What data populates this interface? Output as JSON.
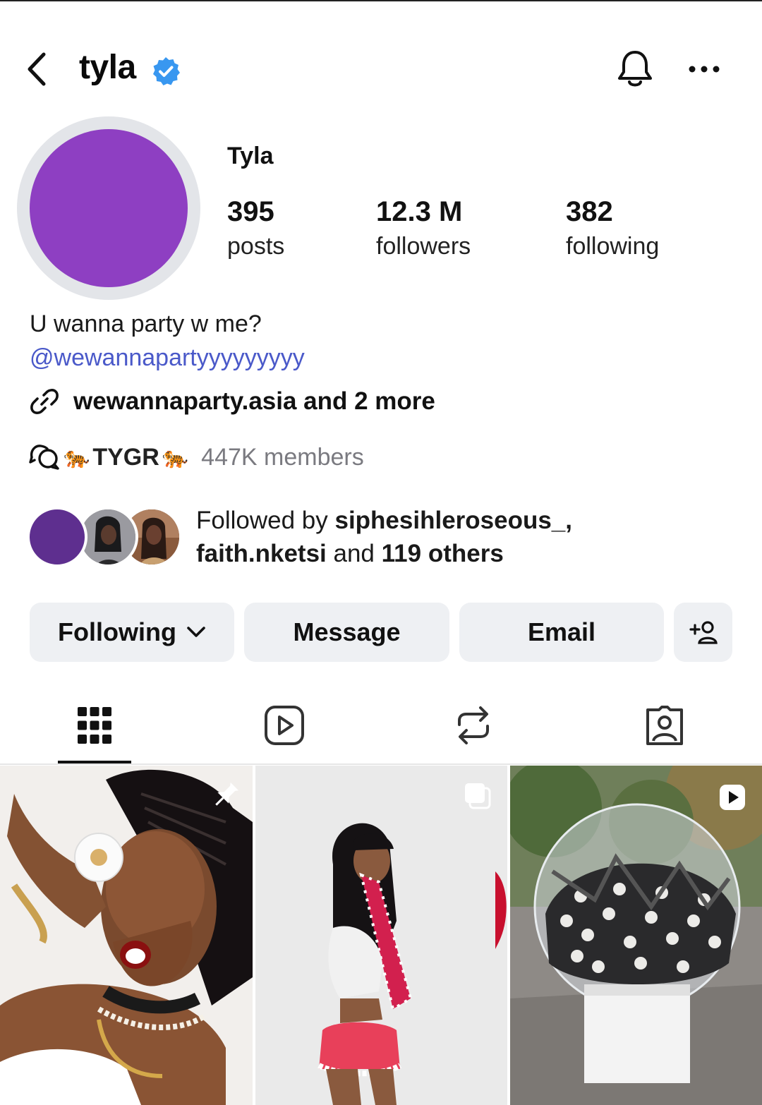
{
  "header": {
    "username": "tyla",
    "verified": true,
    "icons": {
      "back": "chevron-left-icon",
      "verified": "verified-badge-icon",
      "bell": "bell-icon",
      "more": "more-horizontal-icon"
    }
  },
  "profile": {
    "display_name": "Tyla",
    "avatar_color": "#8e3fc2",
    "stats": {
      "posts": {
        "value": "395",
        "label": "posts"
      },
      "followers": {
        "value": "12.3 M",
        "label": "followers"
      },
      "following": {
        "value": "382",
        "label": "following"
      }
    }
  },
  "bio": {
    "text": "U wanna party w me?",
    "handle": "@wewannapartyyyyyyyyy",
    "link_text": "wewannaparty.asia and 2 more",
    "channel": {
      "emoji": "🐅",
      "name": "TYGR",
      "members": "447K members"
    }
  },
  "followed_by": {
    "prefix": "Followed by ",
    "user1": "siphesihleroseous_,",
    "user2": "faith.nketsi",
    "mid": " and ",
    "others": "119 others",
    "avatar_colors": [
      "#5e2f8f",
      "#6f6f73",
      "#7a4a33"
    ]
  },
  "actions": {
    "following": "Following",
    "message": "Message",
    "email": "Email",
    "add_user_icon": "add-person-icon"
  },
  "tabs": [
    "grid-icon",
    "reels-icon",
    "reposts-icon",
    "tagged-icon"
  ],
  "colors": {
    "link_blue": "#4a59c9",
    "verified_blue": "#3897f0",
    "button_bg": "#eef0f3",
    "muted_text": "#7a7a80"
  },
  "grid": {
    "tiles": [
      {
        "name": "post-tile-1",
        "badge": "pin-icon"
      },
      {
        "name": "post-tile-2",
        "badge": "carousel-icon"
      },
      {
        "name": "post-tile-3",
        "badge": "video-icon"
      }
    ]
  }
}
